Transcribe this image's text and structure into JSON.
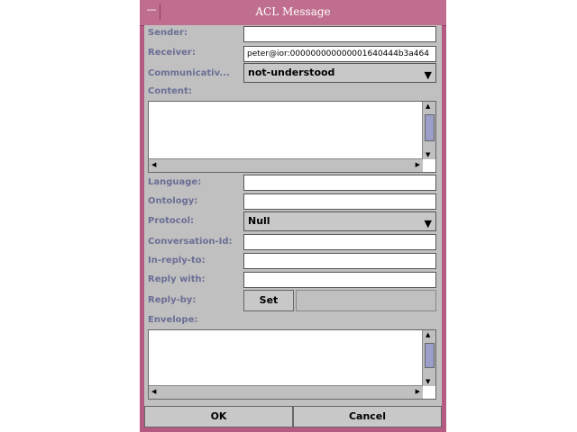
{
  "window": {
    "title": "ACL Message"
  },
  "fields": {
    "sender_label": "Sender:",
    "sender_value": "",
    "receiver_label": "Receiver:",
    "receiver_value": "peter@ior:000000000000001640444b3a464",
    "communicative_label": "Communicativ...",
    "communicative_value": "not-understood",
    "content_label": "Content:",
    "language_label": "Language:",
    "ontology_label": "Ontology:",
    "protocol_label": "Protocol:",
    "protocol_value": "Null",
    "conversation_label": "Conversation-Id:",
    "inreplyto_label": "In-reply-to:",
    "replywith_label": "Reply with:",
    "replyby_label": "Reply-by:",
    "set_label": "Set",
    "envelope_label": "Envelope:"
  },
  "buttons": {
    "ok": "OK",
    "cancel": "Cancel"
  },
  "icons": {
    "combo_arrow": "▼",
    "scroll_up": "▲",
    "scroll_down": "▼",
    "scroll_left": "◀",
    "scroll_right": "▶",
    "window_menu": "—"
  },
  "colors": {
    "frame": "#b55a82",
    "title_bg": "#c06e8f",
    "label": "#6a6e95",
    "panel": "#c0c0c0"
  }
}
